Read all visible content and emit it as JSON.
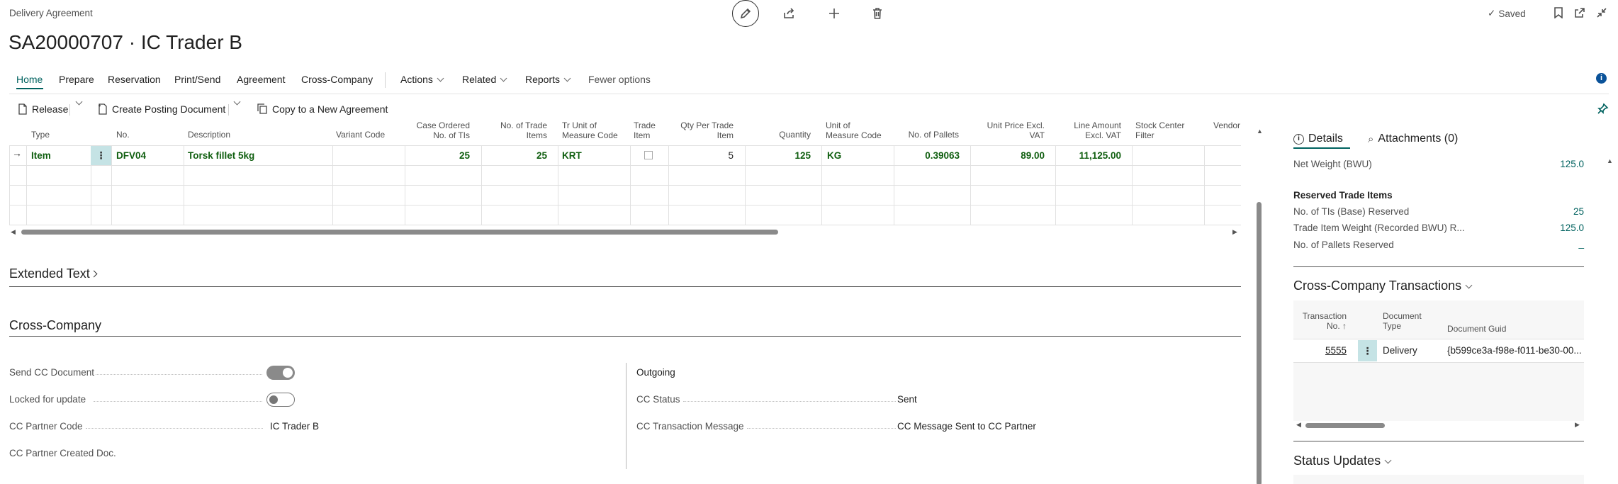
{
  "header": {
    "entity": "Delivery Agreement",
    "title": "SA20000707 · IC Trader B",
    "saved_label": "Saved"
  },
  "tabs": [
    {
      "label": "Home"
    },
    {
      "label": "Prepare"
    },
    {
      "label": "Reservation"
    },
    {
      "label": "Print/Send"
    },
    {
      "label": "Agreement"
    },
    {
      "label": "Cross-Company"
    },
    {
      "label": "Actions"
    },
    {
      "label": "Related"
    },
    {
      "label": "Reports"
    },
    {
      "label": "Fewer options"
    }
  ],
  "actions": {
    "release": "Release",
    "create_posting": "Create Posting Document",
    "copy_agreement": "Copy to a New Agreement"
  },
  "grid": {
    "columns": [
      "Type",
      "No.",
      "Description",
      "Variant Code",
      "Case Ordered\nNo. of TIs",
      "No. of Trade\nItems",
      "Tr Unit of\nMeasure Code",
      "Trade\nItem",
      "Qty Per Trade\nItem",
      "Quantity",
      "Unit of\nMeasure Code",
      "No. of Pallets",
      "Unit Price Excl.\nVAT",
      "Line Amount\nExcl. VAT",
      "Stock Center\nFilter",
      "Vendor"
    ],
    "row": {
      "type": "Item",
      "no": "DFV04",
      "description": "Torsk fillet 5kg",
      "variant": "",
      "case_ordered": "25",
      "trade_items": "25",
      "tr_uom": "KRT",
      "trade_item": false,
      "qty_per_trade": "5",
      "quantity": "125",
      "uom": "KG",
      "pallets": "0.39063",
      "unit_price": "89.00",
      "line_amount": "11,125.00"
    }
  },
  "extended_text": {
    "title": "Extended Text"
  },
  "cross_company": {
    "title": "Cross-Company",
    "send_cc_label": "Send CC Document",
    "send_cc_value": true,
    "locked_label": "Locked for update",
    "locked_value": false,
    "partner_code_label": "CC Partner Code",
    "partner_code_value": "IC Trader B",
    "partner_created_label": "CC Partner Created Doc.",
    "outgoing_label": "Outgoing",
    "cc_status_label": "CC Status",
    "cc_status_value": "Sent",
    "cc_msg_label": "CC Transaction Message",
    "cc_msg_value": "CC Message Sent to CC Partner"
  },
  "factbox": {
    "tab_details": "Details",
    "tab_attachments": "Attachments (0)",
    "net_weight_label": "Net Weight (BWU)",
    "net_weight_value": "125.0",
    "reserved_title": "Reserved Trade Items",
    "tis_reserved_label": "No. of TIs (Base) Reserved",
    "tis_reserved_value": "25",
    "weight_reserved_label": "Trade Item Weight (Recorded BWU) R...",
    "weight_reserved_value": "125.0",
    "pallets_reserved_label": "No. of Pallets Reserved",
    "pallets_reserved_value": "_",
    "cct_title": "Cross-Company Transactions",
    "cct_col_no_1": "Transaction",
    "cct_col_no_2": "No. ↑",
    "cct_col_doctype_1": "Document",
    "cct_col_doctype_2": "Type",
    "cct_col_guid": "Document Guid",
    "cct_row_no": "5555",
    "cct_row_type": "Delivery",
    "cct_row_guid": "{b599ce3a-f98e-f011-be30-00...",
    "status_title": "Status Updates"
  },
  "colors": {
    "accent": "#00625f",
    "grid_text": "#0f5e0f"
  }
}
